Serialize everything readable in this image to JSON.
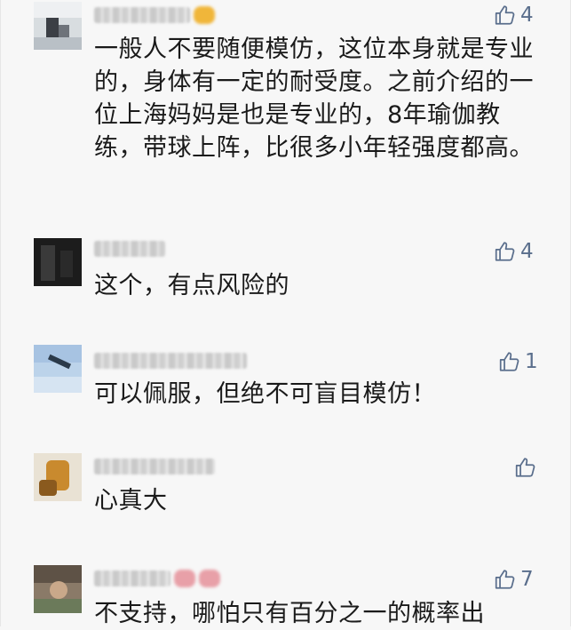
{
  "comments": [
    {
      "text": "一般人不要随便模仿，这位本身就是专业的，身体有一定的耐受度。之前介绍的一位上海妈妈是也是专业的，8年瑜伽教练，带球上阵，比很多小年轻强度都高。",
      "likes": "4"
    },
    {
      "text": "这个，有点风险的",
      "likes": "4"
    },
    {
      "text": "可以佩服，但绝不可盲目模仿！",
      "likes": "1"
    },
    {
      "text": "心真大",
      "likes": ""
    },
    {
      "text": "不支持，哪怕只有百分之一的概率出",
      "likes": "7"
    }
  ],
  "icons": {
    "like": "thumbs-up-icon"
  },
  "colors": {
    "like": "#5a6e8c",
    "text": "#1a1a1a",
    "background": "#f7f7f7"
  }
}
